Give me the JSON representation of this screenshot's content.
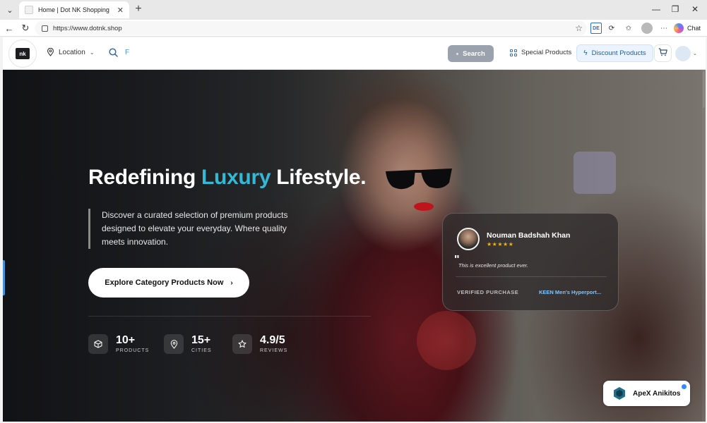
{
  "browser": {
    "tab_title": "Home | Dot NK Shopping",
    "tab_close": "✕",
    "new_tab": "+",
    "url": "https://www.dotnk.shop",
    "chat_label": "Chat",
    "extension_badge": "DE"
  },
  "header": {
    "logo_text": "nk",
    "location_label": "Location",
    "search_value": "F",
    "search_button": "Search",
    "special_products": "Special Products",
    "discount_products": "Discount Products"
  },
  "hero": {
    "title_part1": "Redefining",
    "title_accent": "Luxury",
    "title_part2": "Lifestyle.",
    "description": "Discover a curated selection of premium products designed to elevate your everyday. Where quality meets innovation.",
    "cta_label": "Explore Category Products Now",
    "accent_color": "#35b8d6",
    "stats": [
      {
        "value": "10+",
        "label": "PRODUCTS",
        "icon": "box-icon"
      },
      {
        "value": "15+",
        "label": "CITIES",
        "icon": "pin-icon"
      },
      {
        "value": "4.9/5",
        "label": "REVIEWS",
        "icon": "star-icon"
      }
    ]
  },
  "review": {
    "name": "Nouman Badshah Khan",
    "stars": "★★★★★",
    "quote_mark": "\"",
    "text": "This is excellent product ever.",
    "verified": "VERIFIED PURCHASE",
    "product": "KEEN Men's Hyperport..."
  },
  "badge": {
    "label": "ApeX Anikitos"
  }
}
